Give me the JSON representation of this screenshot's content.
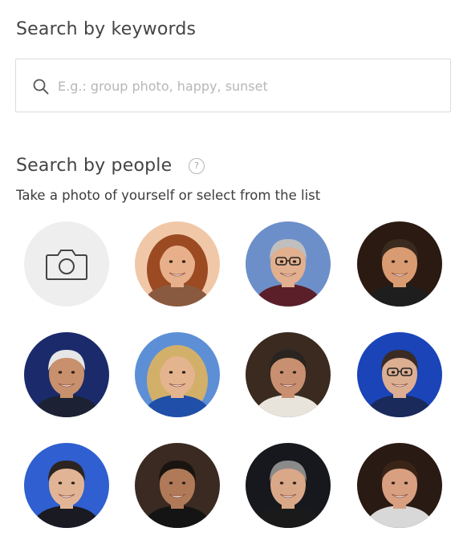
{
  "keywords": {
    "title": "Search by keywords",
    "placeholder": "E.g.: group photo, happy, sunset",
    "value": "",
    "icon": "search-icon"
  },
  "people": {
    "title": "Search by people",
    "help_icon": "question-mark-icon",
    "help_glyph": "?",
    "subtitle": "Take a photo of yourself or select from the list",
    "camera_icon": "camera-icon",
    "faces": [
      {
        "bg": "#f0c8a8",
        "skin": "#e8b08a",
        "hair": "#9b4a22",
        "shirt": "#8a5a40",
        "hairStyle": "long"
      },
      {
        "bg": "#6d8fc9",
        "skin": "#e2b08e",
        "hair": "#bfbfbf",
        "shirt": "#5b1f2a",
        "hairStyle": "short",
        "glasses": true
      },
      {
        "bg": "#2b1a12",
        "skin": "#d99c72",
        "hair": "#3b2a1e",
        "shirt": "#1e1e1e",
        "hairStyle": "short"
      },
      {
        "bg": "#1b2a6b",
        "skin": "#c8906c",
        "hair": "#e6e6e6",
        "shirt": "#1c2233",
        "hairStyle": "short"
      },
      {
        "bg": "#5d8fd6",
        "skin": "#e4b48e",
        "hair": "#d2b06a",
        "shirt": "#1f4fa8",
        "hairStyle": "long"
      },
      {
        "bg": "#3a2a20",
        "skin": "#c89070",
        "hair": "#2a2420",
        "shirt": "#e8e4dc",
        "hairStyle": "short"
      },
      {
        "bg": "#1a44b8",
        "skin": "#dcae92",
        "hair": "#3a2c24",
        "shirt": "#1a2a5a",
        "hairStyle": "short",
        "glasses": true
      },
      {
        "bg": "#2f5fd0",
        "skin": "#e2b496",
        "hair": "#2c2420",
        "shirt": "#1a1a22",
        "hairStyle": "short"
      },
      {
        "bg": "#3a2a22",
        "skin": "#b07a58",
        "hair": "#1a1410",
        "shirt": "#141414",
        "hairStyle": "short"
      },
      {
        "bg": "#16181e",
        "skin": "#d9a888",
        "hair": "#8a8a8a",
        "shirt": "#1a1a1a",
        "hairStyle": "short"
      },
      {
        "bg": "#2a1a14",
        "skin": "#d8a080",
        "hair": "#3a2418",
        "shirt": "#d8d8d8",
        "hairStyle": "short"
      }
    ]
  }
}
